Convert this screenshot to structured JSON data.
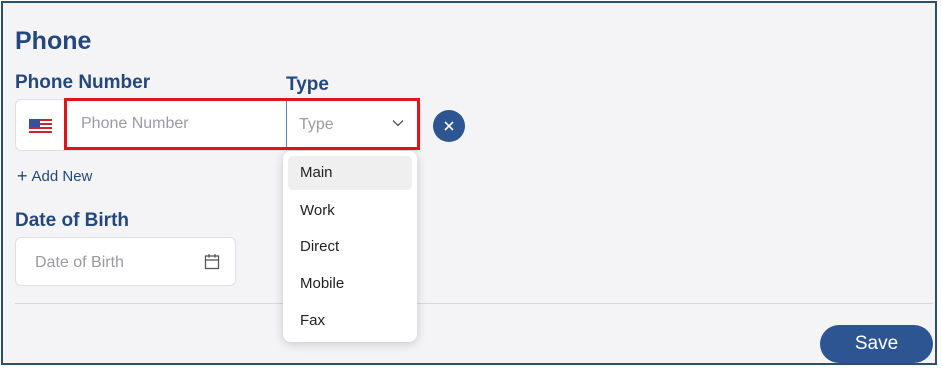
{
  "section": {
    "title": "Phone"
  },
  "phone": {
    "number_label": "Phone Number",
    "type_label": "Type",
    "number_placeholder": "Phone Number",
    "type_placeholder": "Type",
    "country_flag": "us-flag-icon",
    "add_new_label": "Add New"
  },
  "type_dropdown": {
    "options": [
      {
        "label": "Main",
        "selected": true
      },
      {
        "label": "Work",
        "selected": false
      },
      {
        "label": "Direct",
        "selected": false
      },
      {
        "label": "Mobile",
        "selected": false
      },
      {
        "label": "Fax",
        "selected": false
      }
    ]
  },
  "dob": {
    "label": "Date of Birth",
    "placeholder": "Date of Birth"
  },
  "actions": {
    "save_label": "Save"
  },
  "colors": {
    "brand": "#24487e",
    "button": "#2d5591",
    "highlight": "#e0151b",
    "panel_bg": "#f4f4f6"
  }
}
